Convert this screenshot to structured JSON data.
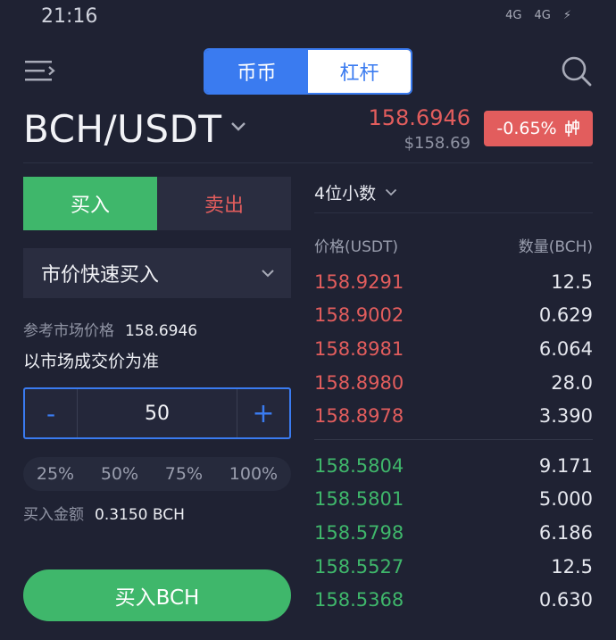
{
  "status": {
    "time": "21:16",
    "signal1": "4G",
    "signal2": "4G"
  },
  "tabs": [
    {
      "label": "币币",
      "active": true
    },
    {
      "label": "杠杆",
      "active": false
    }
  ],
  "pair": "BCH/USDT",
  "price": {
    "last": "158.6946",
    "usd": "$158.69",
    "change": "-0.65%"
  },
  "trade": {
    "buy_label": "买入",
    "sell_label": "卖出",
    "order_type": "市价快速买入",
    "ref_label": "参考市场价格",
    "ref_value": "158.6946",
    "note": "以市场成交价为准",
    "minus": "-",
    "plus": "+",
    "quantity": "50",
    "percents": [
      "25%",
      "50%",
      "75%",
      "100%"
    ],
    "amount_label": "买入金额",
    "amount_value": "0.3150 BCH",
    "submit_label": "买入BCH"
  },
  "orderbook": {
    "decimals": "4位小数",
    "price_header": "价格(USDT)",
    "qty_header": "数量(BCH)",
    "asks": [
      {
        "price": "158.9291",
        "qty": "12.5"
      },
      {
        "price": "158.9002",
        "qty": "0.629"
      },
      {
        "price": "158.8981",
        "qty": "6.064"
      },
      {
        "price": "158.8980",
        "qty": "28.0"
      },
      {
        "price": "158.8978",
        "qty": "3.390"
      }
    ],
    "bids": [
      {
        "price": "158.5804",
        "qty": "9.171"
      },
      {
        "price": "158.5801",
        "qty": "5.000"
      },
      {
        "price": "158.5798",
        "qty": "6.186"
      },
      {
        "price": "158.5527",
        "qty": "12.5"
      },
      {
        "price": "158.5368",
        "qty": "0.630"
      }
    ]
  },
  "colors": {
    "up": "#3fb76b",
    "down": "#e25d5d",
    "accent": "#3a7bf0",
    "background": "#1f2233"
  },
  "icons": [
    "menu-icon",
    "search-icon",
    "chevron-down-icon",
    "candlestick-icon"
  ]
}
